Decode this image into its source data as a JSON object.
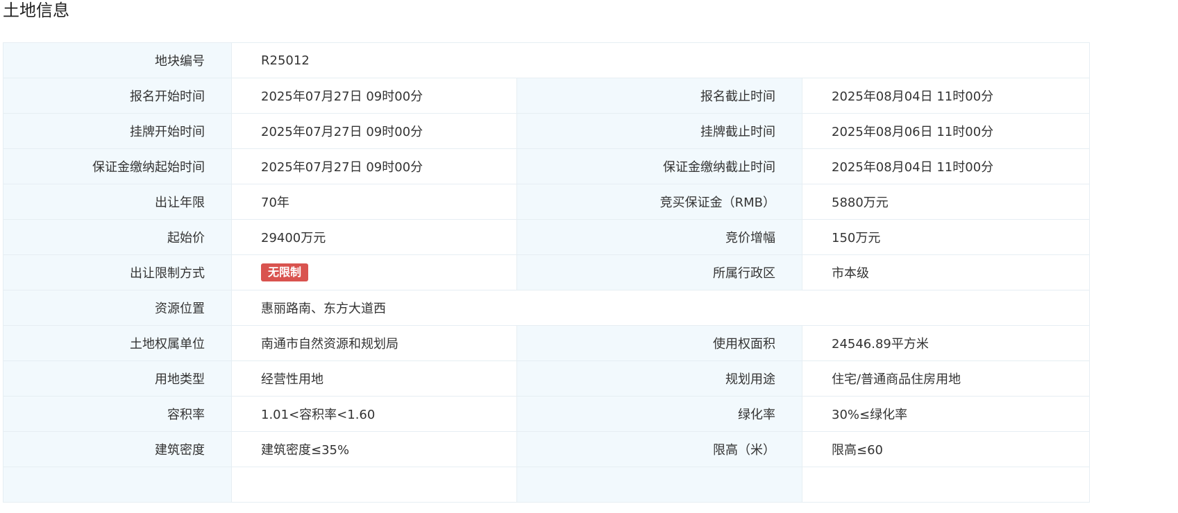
{
  "title": "土地信息",
  "colors": {
    "label_bg": "#f2f9fd",
    "border": "#e6eef3",
    "badge_bg": "#d9534f",
    "badge_text": "#ffffff"
  },
  "parcel_no": {
    "label": "地块编号",
    "value": "R25012"
  },
  "rows": [
    {
      "left": {
        "label": "报名开始时间",
        "value": "2025年07月27日 09时00分"
      },
      "right": {
        "label": "报名截止时间",
        "value": "2025年08月04日 11时00分"
      }
    },
    {
      "left": {
        "label": "挂牌开始时间",
        "value": "2025年07月27日 09时00分"
      },
      "right": {
        "label": "挂牌截止时间",
        "value": "2025年08月06日 11时00分"
      }
    },
    {
      "left": {
        "label": "保证金缴纳起始时间",
        "value": "2025年07月27日 09时00分"
      },
      "right": {
        "label": "保证金缴纳截止时间",
        "value": "2025年08月04日 11时00分"
      }
    },
    {
      "left": {
        "label": "出让年限",
        "value": "70年"
      },
      "right": {
        "label": "竞买保证金（RMB）",
        "value": "5880万元"
      }
    },
    {
      "left": {
        "label": "起始价",
        "value": "29400万元"
      },
      "right": {
        "label": "竞价增幅",
        "value": "150万元"
      }
    }
  ],
  "restriction": {
    "label": "出让限制方式",
    "badge": "无限制",
    "right_label": "所属行政区",
    "right_value": "市本级"
  },
  "location": {
    "label": "资源位置",
    "value": "惠丽路南、东方大道西"
  },
  "rows2": [
    {
      "left": {
        "label": "土地权属单位",
        "value": "南通市自然资源和规划局"
      },
      "right": {
        "label": "使用权面积",
        "value": "24546.89平方米"
      }
    },
    {
      "left": {
        "label": "用地类型",
        "value": "经营性用地"
      },
      "right": {
        "label": "规划用途",
        "value": "住宅/普通商品住房用地"
      }
    },
    {
      "left": {
        "label": "容积率",
        "value": "1.01<容积率<1.60"
      },
      "right": {
        "label": "绿化率",
        "value": "30%≤绿化率"
      }
    },
    {
      "left": {
        "label": "建筑密度",
        "value": "建筑密度≤35%"
      },
      "right": {
        "label": "限高（米）",
        "value": "限高≤60"
      }
    }
  ]
}
